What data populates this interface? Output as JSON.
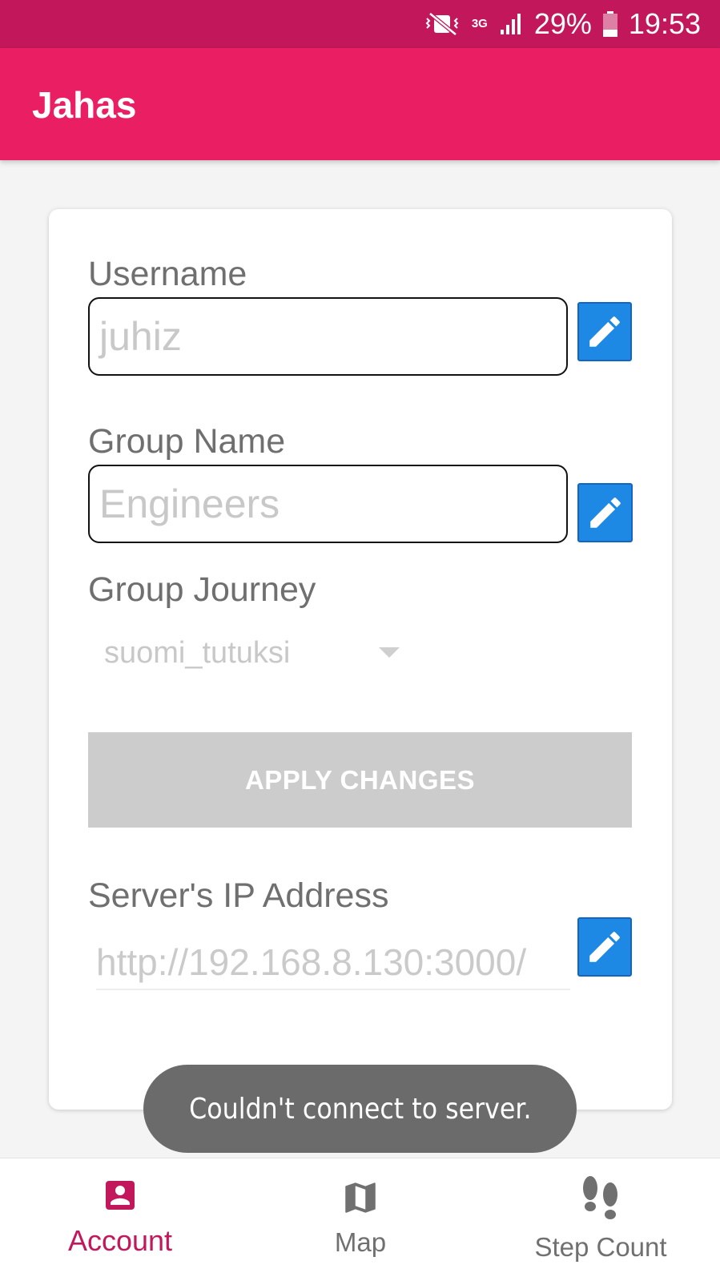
{
  "status_bar": {
    "network": "3G",
    "battery": "29%",
    "time": "19:53",
    "icons": [
      "vibrate-mute-icon",
      "network-3g-icon",
      "signal-icon",
      "battery-icon"
    ]
  },
  "app_bar": {
    "title": "Jahas"
  },
  "account_form": {
    "username": {
      "label": "Username",
      "placeholder": "juhiz"
    },
    "group_name": {
      "label": "Group Name",
      "placeholder": "Engineers"
    },
    "group_journey": {
      "label": "Group Journey",
      "selected": "suomi_tutuksi"
    },
    "apply_button": "APPLY CHANGES",
    "server_ip": {
      "label": "Server's IP Address",
      "placeholder": "http://192.168.8.130:3000/"
    }
  },
  "toast": {
    "message": "Couldn't connect to server."
  },
  "bottom_nav": {
    "items": [
      {
        "label": "Account",
        "icon": "account-icon",
        "active": true
      },
      {
        "label": "Map",
        "icon": "map-icon",
        "active": false
      },
      {
        "label": "Step Count",
        "icon": "footsteps-icon",
        "active": false
      }
    ]
  },
  "colors": {
    "status_bar": "#c2185b",
    "app_bar": "#e91e63",
    "edit_button": "#1e88e5",
    "active_nav": "#c2185b",
    "disabled_button": "#cccccc",
    "toast": "#6b6b6b"
  }
}
